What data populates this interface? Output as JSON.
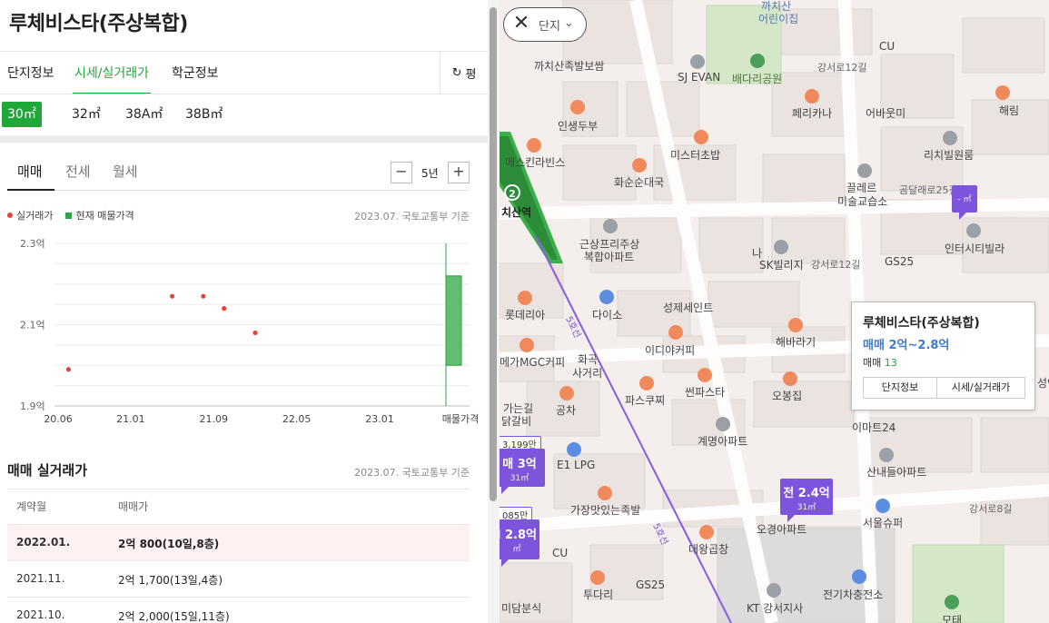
{
  "complex": {
    "name": "루체비스타(주상복합)"
  },
  "tabs": {
    "info": "단지정보",
    "price": "시세/실거래가",
    "school": "학군정보",
    "pyeong": "평"
  },
  "areas": [
    "30㎡",
    "32㎡",
    "38A㎡",
    "38B㎡"
  ],
  "deal_types": [
    "매매",
    "전세",
    "월세"
  ],
  "period": {
    "label": "5년",
    "minus": "−",
    "plus": "+"
  },
  "legend": {
    "actual": "실거래가",
    "asking": "현재 매물가격"
  },
  "basis_note": "2023.07. 국토교통부 기준",
  "chart_data": {
    "type": "scatter",
    "y_ticks": [
      "2.3억",
      "2.1억",
      "1.9억"
    ],
    "x_ticks": [
      "20.06",
      "21.01",
      "21.09",
      "22.05",
      "23.01",
      "매물가격"
    ],
    "ylim": [
      1.9,
      2.3
    ],
    "points": [
      {
        "x": "2020.07",
        "y": 1.99
      },
      {
        "x": "2021.05",
        "y": 2.17
      },
      {
        "x": "2021.08",
        "y": 2.17
      },
      {
        "x": "2021.10",
        "y": 2.14
      },
      {
        "x": "2022.01",
        "y": 2.08
      }
    ],
    "asking_range": [
      2.0,
      2.22
    ]
  },
  "history": {
    "title": "매매 실거래가",
    "col_date": "계약월",
    "col_price": "매매가",
    "rows": [
      {
        "date": "2022.01.",
        "price": "2억 800(10일,8층)"
      },
      {
        "date": "2021.11.",
        "price": "2억 1,700(13일,4층)"
      },
      {
        "date": "2021.10.",
        "price": "2억 2,000(15일,11층)"
      }
    ]
  },
  "map": {
    "filter_label": "단지",
    "popup": {
      "name": "루체비스타(주상복합)",
      "price": "매매 2억~2.8억",
      "count_label": "매매",
      "count": "13",
      "btn_info": "단지정보",
      "btn_price": "시세/실거래가"
    },
    "markers": {
      "m1_top": "3,199만",
      "m1_big": "매 3억",
      "m1_area": "31㎡",
      "m2_top": "085만",
      "m2_big": "l 2.8억",
      "m2_area": "㎡",
      "m3_big": "전 2.4억",
      "m3_area": "31㎡",
      "m4_area": "- ㎡"
    },
    "station": {
      "line_num": "2",
      "name": "치산역"
    },
    "line5": "5호선",
    "labels": {
      "kkachisan": "까치산",
      "kids": "어린이집",
      "cu1": "CU",
      "jokbal": "까치산족발보쌈",
      "sjevan": "SJ EVAN",
      "baedari": "배다리공원",
      "gangseo12": "강서로12길",
      "perikana": "페리카나",
      "eobae": "어바웃미",
      "haerim": "해림",
      "insaeng": "인생두부",
      "mister": "미스터초밥",
      "richville": "리치빌원룸",
      "mecca": "메스킨라빈스",
      "hwasun": "화순순대국",
      "kkoleure": "끌레르",
      "misul": "미술교습소",
      "gomdal": "곰달래로25길",
      "gunsang": "근상프리주상",
      "bokhap": "복합아파트",
      "na": "나",
      "skvilla": "SK빌리지",
      "gangseo12b": "강서로12길",
      "gs25a": "GS25",
      "intercity": "인터시티빌라",
      "daiso": "다이소",
      "seongje": "성제세인트",
      "roti": "롯데리아",
      "haebaragi": "해바라기",
      "idiya": "이디야커피",
      "mega": "메가MGC커피",
      "hwagok": "화곡",
      "sageori": "사거리",
      "paskucci": "파스쿠찌",
      "sseonpa": "썬파스타",
      "obong": "오봉집",
      "kajin": "가는길",
      "galbi": "닭갈비",
      "gongcha": "공차",
      "gyemyeong": "계명아파트",
      "sandeul": "산내들아파트",
      "e1": "E1 LPG",
      "gajang": "가장맛있는족발",
      "emart24": "이마트24",
      "seongin": "성인",
      "cu2": "CU",
      "ogyeong": "오경아파트",
      "gangseo8": "강서로8길",
      "seoulsuper": "서울슈퍼",
      "daewang": "대왕곱창",
      "gs25b": "GS25",
      "tudari": "투다리",
      "kt": "KT 강서지사",
      "charging": "전기차충전소",
      "motae": "모태",
      "midam": "미담분식"
    }
  }
}
